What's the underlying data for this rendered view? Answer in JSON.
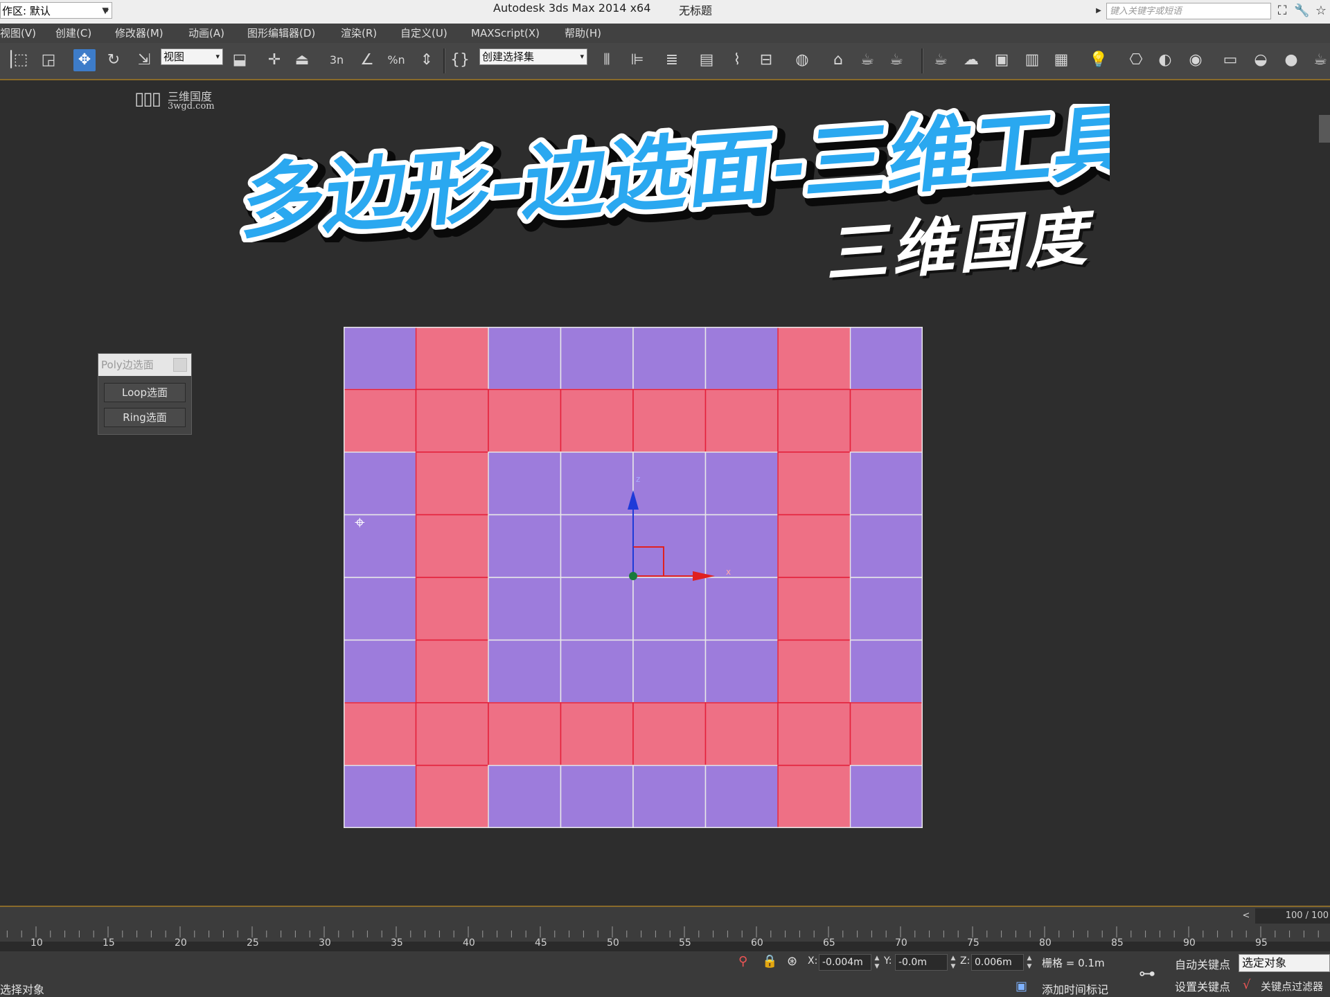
{
  "titlebar": {
    "workspace_label": "作区: 默认",
    "app_title": "Autodesk 3ds Max  2014 x64",
    "doc_title": "无标题",
    "keyword_search_placeholder": "键入关键字或短语"
  },
  "menu": {
    "items": [
      "视图(V)",
      "创建(C)",
      "修改器(M)",
      "动画(A)",
      "图形编辑器(D)",
      "渲染(R)",
      "自定义(U)",
      "MAXScript(X)",
      "帮助(H)"
    ]
  },
  "toolbar": {
    "ref_coord_value": "视图",
    "selection_set_value": "创建选择集",
    "snap_labels": [
      "3n",
      "%n"
    ]
  },
  "watermark": {
    "cn": "三维国度",
    "url": "3wgd.com"
  },
  "overlay": {
    "title": "多边形-边选面-三维工具箱",
    "signature": "三维国度",
    "title_fill": "#2aa8f0",
    "title_outline": "#ffffff",
    "title_shadow": "#0a0a0a"
  },
  "poly_panel": {
    "title": "Poly边选面",
    "loop_button": "Loop选面",
    "ring_button": "Ring选面"
  },
  "mesh": {
    "cols": 8,
    "rows": 8,
    "selected_rows": [
      1,
      6
    ],
    "selected_cols": [
      1,
      6
    ],
    "face_color": "#9d7cdc",
    "selected_color": "#ee7085",
    "edge_color": "#e8e8e8",
    "selected_edge_color": "#e3203a"
  },
  "gizmo": {
    "z_label": "z",
    "x_label": "x",
    "z_color": "#1e3ad8",
    "x_color": "#e02020"
  },
  "timeline": {
    "frame_display": "100 / 100",
    "prev_button": "<",
    "tick_labels": [
      "10",
      "15",
      "20",
      "25",
      "30",
      "35",
      "40",
      "45",
      "50",
      "55",
      "60",
      "65",
      "70",
      "75",
      "80",
      "85",
      "90",
      "95"
    ]
  },
  "status": {
    "message": "选择对象",
    "x_label": "X:",
    "x_value": "-0.004m",
    "y_label": "Y:",
    "y_value": "-0.0m",
    "z_label": "Z:",
    "z_value": "0.006m",
    "grid": "栅格 = 0.1m",
    "auto_key": "自动关键点",
    "set_key": "设置关键点",
    "selected_object": "选定对象",
    "add_time_tag": "添加时间标记",
    "key_filters": "关键点过滤器"
  }
}
